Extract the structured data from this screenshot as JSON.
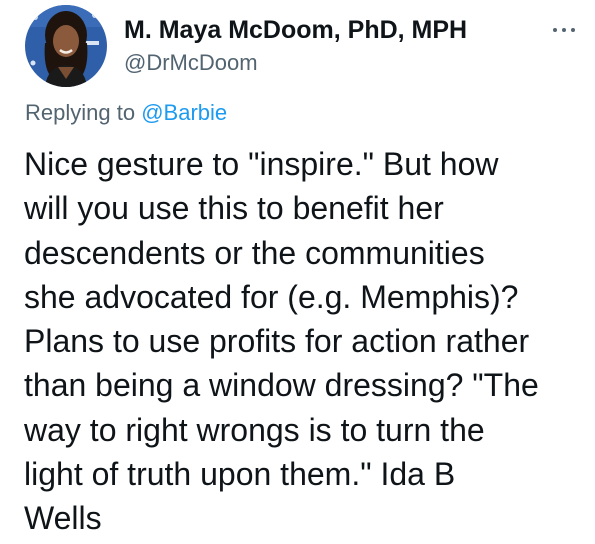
{
  "tweet": {
    "author": {
      "display_name": "M. Maya McDoom, PhD, MPH",
      "handle": "@DrMcDoom",
      "avatar_icon": "profile-photo"
    },
    "more_icon": "more-options-icon",
    "reply_context": {
      "prefix": "Replying to",
      "mention": "@Barbie"
    },
    "text_lines": [
      "Nice gesture to \"inspire.\" But how",
      "will you use this to benefit her",
      "descendents or the communities",
      "she advocated for (e.g. Memphis)?",
      "Plans to use profits for action rather",
      "than being a window dressing? \"The",
      "way to right wrongs is to turn the",
      "light of truth upon them.\" Ida B",
      "Wells"
    ],
    "colors": {
      "text": "#0f1419",
      "secondary": "#536471",
      "link": "#1d9bf0"
    }
  }
}
